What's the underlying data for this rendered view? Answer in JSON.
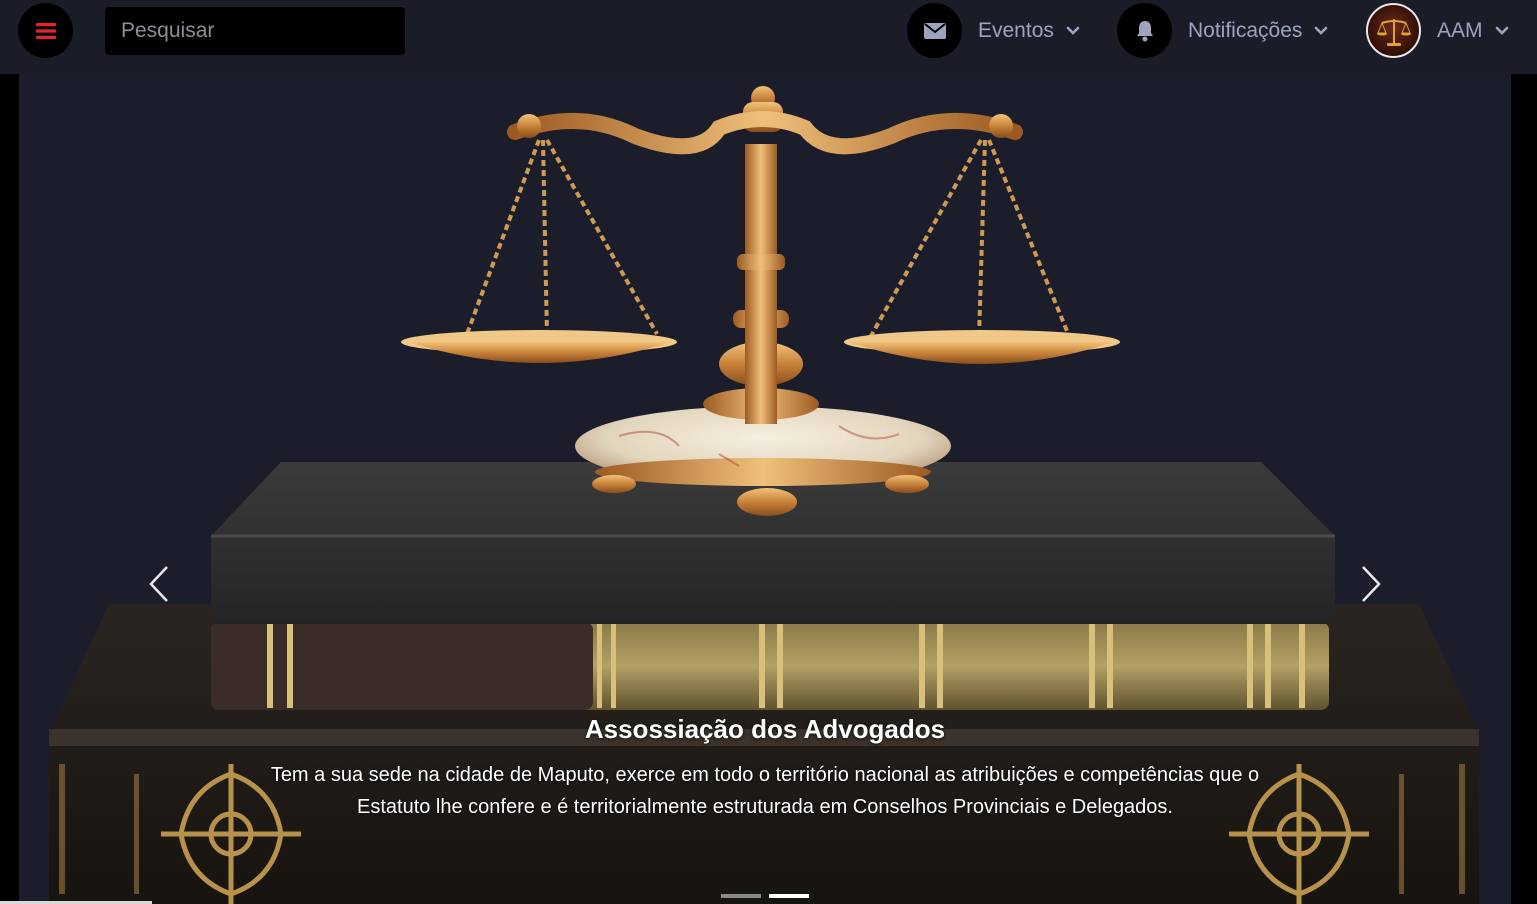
{
  "colors": {
    "topbar_bg": "#1a1d27",
    "accent": "#e0262c",
    "nav_text": "#9ea3c0",
    "hero_bg": "#1b1e2a"
  },
  "topbar": {
    "menu_icon": "bars-icon",
    "search": {
      "placeholder": "Pesquisar",
      "value": ""
    },
    "events": {
      "label": "Eventos",
      "icon": "envelope-icon"
    },
    "notifications": {
      "label": "Notificações",
      "icon": "bell-icon"
    },
    "user": {
      "label": "AAM",
      "avatar": "scales-of-justice-logo"
    }
  },
  "carousel": {
    "slide_count": 2,
    "active_index": 1,
    "caption_title": "Assossiação dos Advogados",
    "caption_text": "Tem a sua sede na cidade de Maputo, exerce em todo o território nacional as atribuições e competências que o Estatuto lhe confere e é territorialmente estruturada em Conselhos Provinciais e Delegados.",
    "prev_icon": "chevron-left-icon",
    "next_icon": "chevron-right-icon"
  }
}
